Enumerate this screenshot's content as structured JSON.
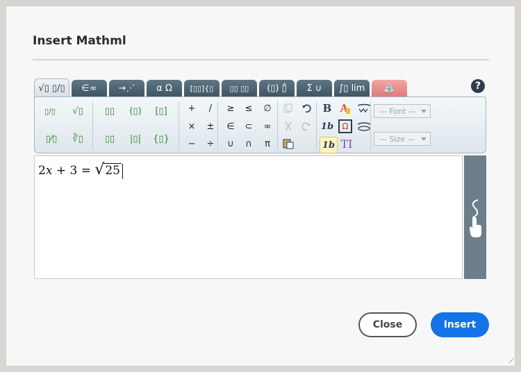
{
  "dialog": {
    "title": "Insert Mathml",
    "close_label": "Close",
    "insert_label": "Insert",
    "help_label": "?"
  },
  "tabs": [
    {
      "label": "√▯ ▯/▯",
      "active": true
    },
    {
      "label": "∈∞"
    },
    {
      "label": "→⋰"
    },
    {
      "label": "α Ω"
    },
    {
      "label": "[▯▯]{▯"
    },
    {
      "label": "▯▯ ▯▯"
    },
    {
      "label": "(▯) ▯̂"
    },
    {
      "label": "Σ ∪"
    },
    {
      "label": "∫▯ lim"
    },
    {
      "label": "⛲"
    }
  ],
  "toolbar": {
    "templates": [
      "▯/▯",
      "√▯",
      "▯▯",
      "(▯)",
      "[▯]",
      "▯⁄▯",
      "∛▯",
      "▯▯",
      "|▯|",
      "{▯}"
    ],
    "operators": [
      "+",
      "/",
      "≥",
      "≤",
      "∅",
      "×",
      "±",
      "∈",
      "⊂",
      "∞",
      "−",
      "÷",
      "∪",
      "∩",
      "π"
    ],
    "edit_icons": [
      "copy",
      "undo",
      "cut",
      "redo",
      "paste"
    ],
    "format": {
      "bold": "B",
      "italic": "1b",
      "normal": "1b",
      "text": "TI"
    },
    "font_label": "— Font —",
    "size_label": "— Size —"
  },
  "editor": {
    "formula_a": "2",
    "formula_x": "x",
    "formula_b": " + 3 = ",
    "formula_radicand": "25"
  },
  "colors": {
    "primary": "#1473e6",
    "tab": "#4d6473",
    "hand_panel": "#6c7e89"
  }
}
